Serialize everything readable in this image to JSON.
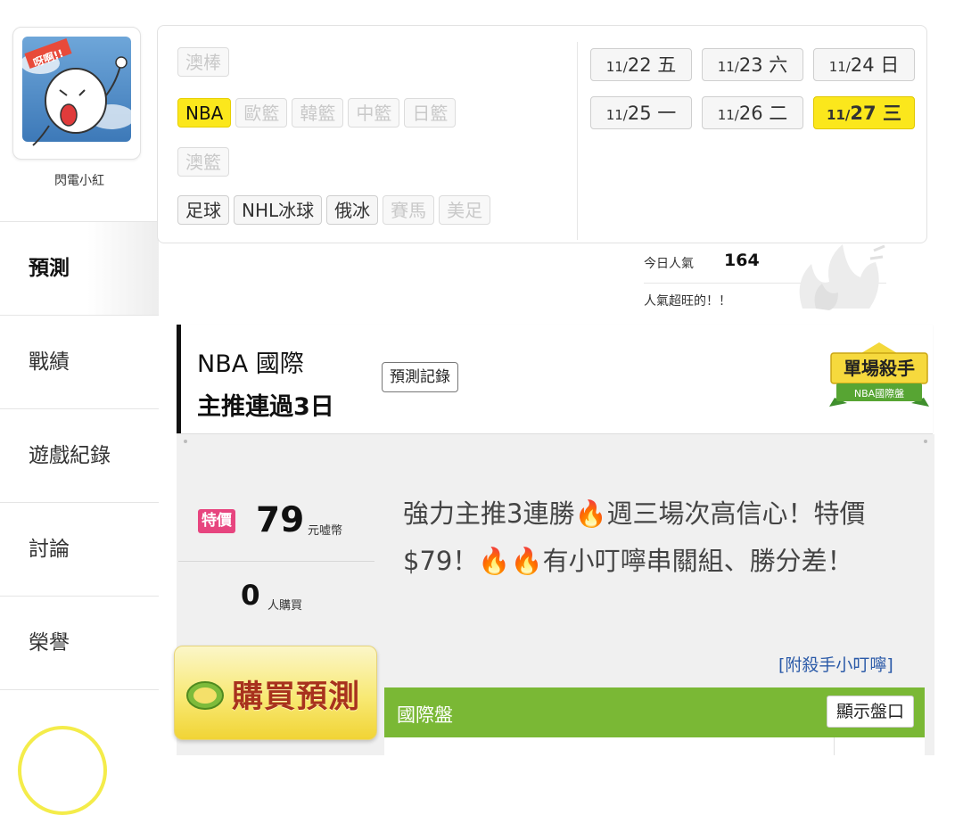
{
  "user": {
    "name": "閃電小紅",
    "avatar_text": "呀啊!!"
  },
  "sidebar": {
    "items": [
      {
        "label": "預測",
        "active": true
      },
      {
        "label": "戰績"
      },
      {
        "label": "遊戲紀錄"
      },
      {
        "label": "討論"
      },
      {
        "label": "榮譽"
      }
    ]
  },
  "categories": {
    "row1": [
      {
        "label": "澳棒",
        "enabled": false
      }
    ],
    "row2": [
      {
        "label": "NBA",
        "selected": true
      },
      {
        "label": "歐籃",
        "enabled": false
      },
      {
        "label": "韓籃",
        "enabled": false
      },
      {
        "label": "中籃",
        "enabled": false
      },
      {
        "label": "日籃",
        "enabled": false
      }
    ],
    "row3": [
      {
        "label": "澳籃",
        "enabled": false
      }
    ],
    "row4": [
      {
        "label": "足球",
        "enabled": true
      },
      {
        "label": "NHL冰球",
        "enabled": true
      },
      {
        "label": "俄冰",
        "enabled": true
      },
      {
        "label": "賽馬",
        "enabled": false
      },
      {
        "label": "美足",
        "enabled": false
      }
    ]
  },
  "dates": [
    {
      "md": "11/",
      "d": "22",
      "wd": "五"
    },
    {
      "md": "11/",
      "d": "23",
      "wd": "六"
    },
    {
      "md": "11/",
      "d": "24",
      "wd": "日"
    },
    {
      "md": "11/",
      "d": "25",
      "wd": "一"
    },
    {
      "md": "11/",
      "d": "26",
      "wd": "二"
    },
    {
      "md": "11/",
      "d": "27",
      "wd": "三",
      "selected": true
    }
  ],
  "popularity": {
    "label": "今日人氣",
    "value": "164",
    "sub": "人氣超旺的！！"
  },
  "prediction": {
    "title_line1": "NBA 國際",
    "title_line2": "主推連過3日",
    "record_button": "預測記錄",
    "badge_title": "單場殺手",
    "badge_sub": "NBA國際盤"
  },
  "offer": {
    "tag": "特價",
    "price": "79",
    "price_unit": "元嘘幣",
    "buyers": "0",
    "buyers_unit": "人購買",
    "description": "強力主推3連勝🔥週三場次高信心！特價$79！🔥🔥有小叮嚀串關組、勝分差！",
    "buy_button": "購買預測",
    "kill_link": "[附殺手小叮嚀]"
  },
  "odds_bar": {
    "label": "國際盤",
    "button": "顯示盤口"
  },
  "colors": {
    "accent_yellow": "#fbe71c",
    "tag_pink": "#e7457f",
    "bar_green": "#7ab835",
    "link_blue": "#2b5aa8",
    "button_text": "#a8321d"
  }
}
